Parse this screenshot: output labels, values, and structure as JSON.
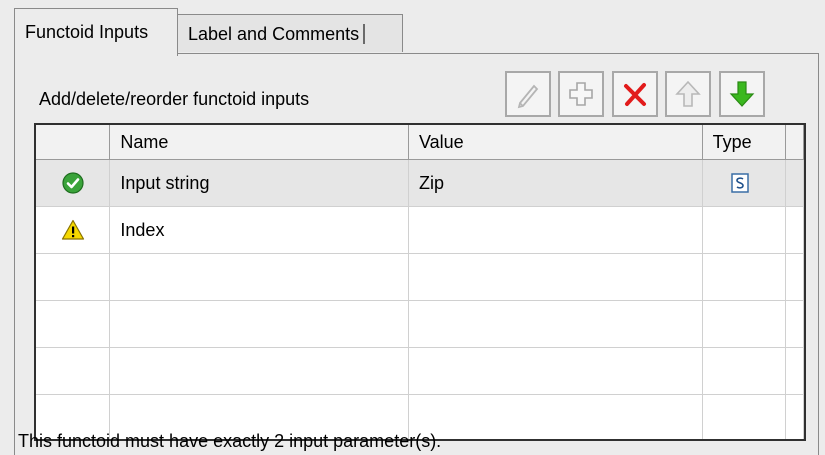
{
  "tabs": [
    {
      "label": "Functoid Inputs",
      "active": true
    },
    {
      "label": "Label and Comments",
      "active": false
    }
  ],
  "caption": "Add/delete/reorder functoid inputs",
  "toolbar": {
    "icons": [
      "pencil-icon",
      "plus-icon",
      "delete-x-icon",
      "arrow-up-icon",
      "arrow-down-icon"
    ]
  },
  "table": {
    "headers": {
      "name": "Name",
      "value": "Value",
      "type": "Type"
    },
    "rows": [
      {
        "status": "valid-checkmark-icon",
        "name": "Input string",
        "value": "Zip",
        "type_icon": "string-type-icon"
      },
      {
        "status": "warning-icon",
        "name": "Index",
        "value": "",
        "type_icon": ""
      }
    ]
  },
  "footer": "This functoid must have exactly 2 input parameter(s).",
  "colors": {
    "valid": "#3aa33a",
    "warning": "#f5d800",
    "delete": "#e21b1b",
    "arrow_down": "#3bb81f"
  }
}
